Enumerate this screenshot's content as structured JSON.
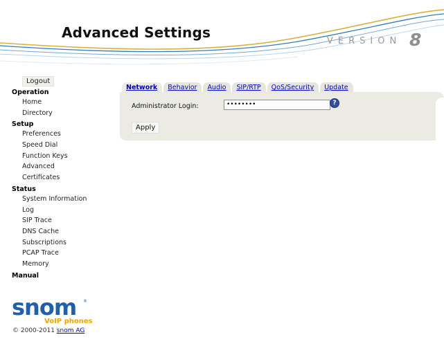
{
  "header": {
    "title": "Advanced Settings",
    "version_label": "VERSION",
    "version_number": "8"
  },
  "sidebar": {
    "logout": "Logout",
    "sections": [
      {
        "title": "Operation",
        "items": [
          "Home",
          "Directory"
        ]
      },
      {
        "title": "Setup",
        "items": [
          "Preferences",
          "Speed Dial",
          "Function Keys",
          "Advanced",
          "Certificates"
        ]
      },
      {
        "title": "Status",
        "items": [
          "System Information",
          "Log",
          "SIP Trace",
          "DNS Cache",
          "Subscriptions",
          "PCAP Trace",
          "Memory"
        ]
      },
      {
        "title": "Manual",
        "items": []
      }
    ]
  },
  "tabs": [
    {
      "label": "Network",
      "active": true
    },
    {
      "label": "Behavior",
      "active": false
    },
    {
      "label": "Audio",
      "active": false
    },
    {
      "label": "SIP/RTP",
      "active": false
    },
    {
      "label": "QoS/Security",
      "active": false
    },
    {
      "label": "Update",
      "active": false
    }
  ],
  "form": {
    "admin_login_label": "Administrator Login:",
    "admin_login_value": "••••••••",
    "help_glyph": "?",
    "apply_label": "Apply"
  },
  "footer": {
    "logo_text": "snom",
    "logo_sub": "VoIP phones",
    "copyright": "© 2000-2011",
    "company_link": "snom AG"
  },
  "colors": {
    "link": "#0000cc",
    "panel": "#ebebe4",
    "logo_blue": "#1f5fae",
    "logo_orange": "#f5a300",
    "swoosh_blue": "#2e7ec4",
    "swoosh_gold": "#d9b13a"
  },
  "icons": {
    "help": "question-circle-icon"
  }
}
